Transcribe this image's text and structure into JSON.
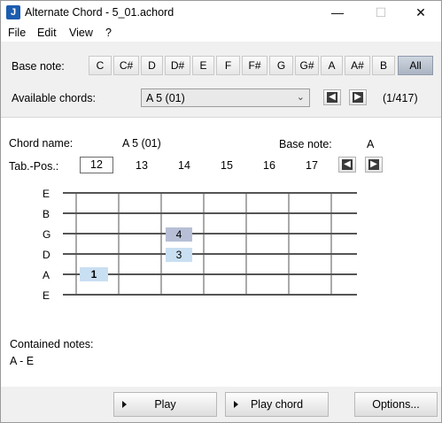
{
  "window": {
    "title": "Alternate Chord - 5_01.achord",
    "app_icon": "J",
    "controls": {
      "minimize": "—",
      "maximize": "☐",
      "close": "✕"
    }
  },
  "menu": [
    "File",
    "Edit",
    "View",
    "?"
  ],
  "base_note_row": {
    "label": "Base note:",
    "notes": [
      "C",
      "C#",
      "D",
      "D#",
      "E",
      "F",
      "F#",
      "G",
      "G#",
      "A",
      "A#",
      "B",
      "All"
    ],
    "selected": "All"
  },
  "available_chords": {
    "label": "Available chords:",
    "selected": "A 5 (01)",
    "counter": "(1/417)"
  },
  "chord": {
    "name_label": "Chord name:",
    "name": "A 5 (01)",
    "base_note_label": "Base note:",
    "base_note": "A",
    "tab_pos_label": "Tab.-Pos.:",
    "positions": [
      "12",
      "13",
      "14",
      "15",
      "16",
      "17"
    ],
    "strings": [
      "E",
      "B",
      "G",
      "D",
      "A",
      "E"
    ],
    "fingerings": [
      {
        "string": "G",
        "fret_position": "14",
        "finger": "4"
      },
      {
        "string": "D",
        "fret_position": "14",
        "finger": "3"
      },
      {
        "string": "A",
        "fret_position": "12",
        "finger": "1"
      }
    ],
    "contained_notes_label": "Contained notes:",
    "contained_notes": "A - E"
  },
  "buttons": {
    "play": "Play",
    "play_chord": "Play chord",
    "options": "Options..."
  },
  "colors": {
    "fingering": "#c9dff2",
    "fingering_dim": "#b6bfd6",
    "selected_note": "#aab4c2"
  },
  "icons": [
    "left-arrow-icon",
    "right-arrow-icon",
    "play-triangle-icon"
  ]
}
